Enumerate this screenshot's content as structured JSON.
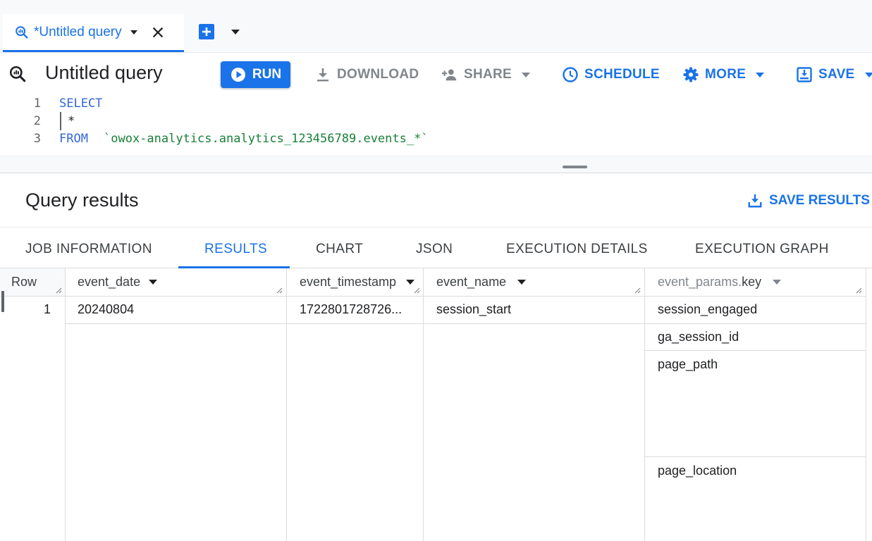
{
  "tab": {
    "label": "*Untitled query"
  },
  "toolbar": {
    "title": "Untitled query",
    "run": "RUN",
    "download": "DOWNLOAD",
    "share": "SHARE",
    "schedule": "SCHEDULE",
    "more": "MORE",
    "save": "SAVE"
  },
  "editor": {
    "lines": [
      {
        "num": "1",
        "keyword": "SELECT",
        "text": ""
      },
      {
        "num": "2",
        "keyword": "",
        "text": "*"
      },
      {
        "num": "3",
        "keyword": "FROM",
        "text": "`owox-analytics.analytics_123456789.events_*`"
      }
    ]
  },
  "results": {
    "title": "Query results",
    "save_label": "SAVE RESULTS",
    "tabs": [
      "JOB INFORMATION",
      "RESULTS",
      "CHART",
      "JSON",
      "EXECUTION DETAILS",
      "EXECUTION GRAPH"
    ],
    "active_tab": "RESULTS",
    "columns": {
      "row": "Row",
      "event_date": "event_date",
      "event_timestamp": "event_timestamp",
      "event_name": "event_name",
      "event_params_key_prefix": "event_params.",
      "event_params_key_suffix": "key"
    },
    "row": {
      "num": "1",
      "event_date": "20240804",
      "event_timestamp": "1722801728726...",
      "event_name": "session_start",
      "keys": [
        "session_engaged",
        "ga_session_id",
        "page_path",
        "page_location"
      ]
    }
  },
  "colors": {
    "accent": "#1a73e8",
    "keyword": "#3367d6",
    "string": "#188038"
  }
}
